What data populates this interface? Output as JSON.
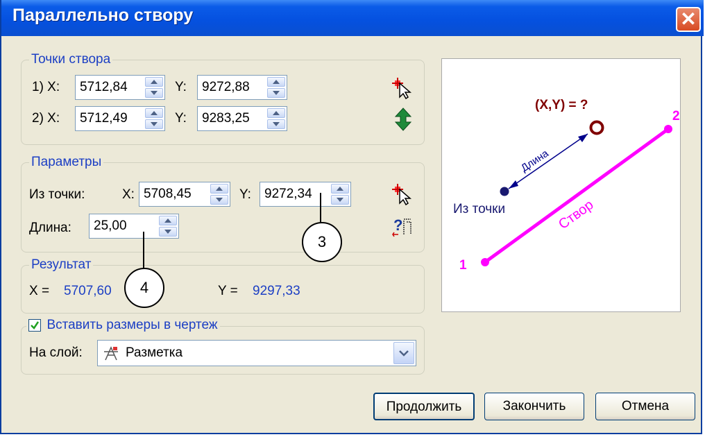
{
  "window": {
    "title": "Параллельно створу",
    "close_glyph": "✕"
  },
  "points_group": {
    "title": "Точки створа",
    "row1": {
      "label": "1) X:",
      "x": "5712,84",
      "ylabel": "Y:",
      "y": "9272,88"
    },
    "row2": {
      "label": "2) X:",
      "x": "5712,49",
      "ylabel": "Y:",
      "y": "9283,25"
    }
  },
  "params_group": {
    "title": "Параметры",
    "from_label": "Из точки:",
    "x_label": "X:",
    "x": "5708,45",
    "y_label": "Y:",
    "y": "9272,34",
    "length_label": "Длина:",
    "length": "25,00"
  },
  "result_group": {
    "title": "Результат",
    "x_label": "X =",
    "x": "5707,60",
    "y_label": "Y =",
    "y": "9297,33"
  },
  "insert_group": {
    "checkbox_label": "Вставить размеры в чертеж",
    "checked": true,
    "layer_label": "На слой:",
    "layer_value": "Разметка"
  },
  "preview": {
    "xy_label": "(X,Y) = ?",
    "length_label": "Длина",
    "from_label": "Из точки",
    "line_label": "Створ",
    "point1": "1",
    "point2": "2",
    "colors": {
      "line": "#ff00ff",
      "xy": "#800000",
      "length": "#00008b",
      "from": "#191970"
    }
  },
  "buttons": {
    "continue": "Продолжить",
    "finish": "Закончить",
    "cancel": "Отмена"
  },
  "callouts": {
    "c3": "3",
    "c4": "4"
  },
  "icons": [
    "pick-point-icon",
    "swap-points-icon",
    "pick-point-icon",
    "query-length-icon",
    "layer-icon",
    "dropdown-arrow-icon"
  ]
}
